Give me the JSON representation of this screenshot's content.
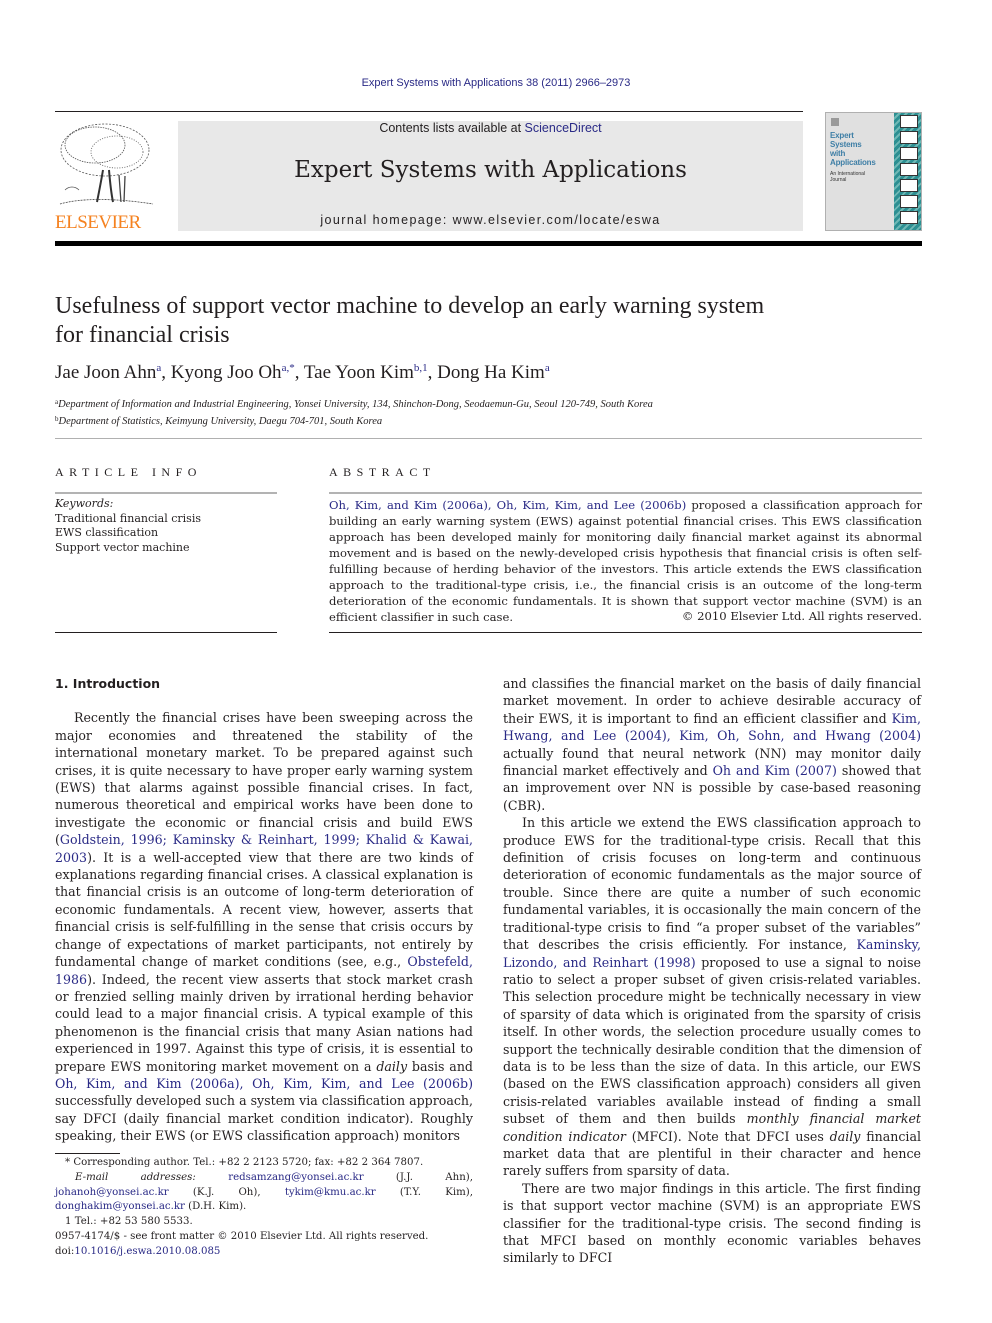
{
  "header": {
    "running_head": "Expert Systems with Applications 38 (2011) 2966–2973",
    "contents_prefix": "Contents lists available at ",
    "contents_link": "ScienceDirect",
    "journal_name": "Expert Systems with Applications",
    "homepage": "journal homepage: www.elsevier.com/locate/eswa",
    "publisher": "ELSEVIER",
    "cover_title_lines": [
      "Expert",
      "Systems",
      "with",
      "Applications"
    ],
    "cover_subtitle_lines": [
      "An International",
      "Journal"
    ],
    "colors": {
      "elsevier_orange": "#f58220",
      "link_blue": "#2a2a86",
      "masthead_gray": "#e8e8e8"
    }
  },
  "article": {
    "title_line1": "Usefulness of support vector machine to develop an early warning system",
    "title_line2": "for financial crisis",
    "authors": [
      {
        "name": "Jae Joon Ahn",
        "sup": "a",
        "sep": ", "
      },
      {
        "name": "Kyong Joo Oh",
        "sup": "a,*",
        "sep": ", "
      },
      {
        "name": "Tae Yoon Kim",
        "sup": "b,1",
        "sep": ", "
      },
      {
        "name": "Dong Ha Kim",
        "sup": "a",
        "sep": ""
      }
    ],
    "affiliations": [
      {
        "sup": "a",
        "text": "Department of Information and Industrial Engineering, Yonsei University, 134, Shinchon-Dong, Seodaemun-Gu, Seoul 120-749, South Korea"
      },
      {
        "sup": "b",
        "text": "Department of Statistics, Keimyung University, Daegu 704-701, South Korea"
      }
    ]
  },
  "article_info": {
    "heading": "ARTICLE INFO",
    "keywords_label": "Keywords:",
    "keywords": [
      "Traditional financial crisis",
      "EWS classification",
      "Support vector machine"
    ]
  },
  "abstract": {
    "heading": "ABSTRACT",
    "link": "Oh, Kim, and Kim (2006a), Oh, Kim, Kim, and Lee (2006b)",
    "text": " proposed a classification approach for building an early warning system (EWS) against potential financial crises. This EWS classification approach has been developed mainly for monitoring daily financial market against its abnormal movement and is based on the newly-developed crisis hypothesis that financial crisis is often self-fulfilling because of herding behavior of the investors. This article extends the EWS classification approach to the tradi­tional-type crisis, i.e., the financial crisis is an outcome of the long-term deterioration of the economic fundamentals. It is shown that support vector machine (SVM) is an efficient classifier in such case.",
    "copyright": "© 2010 Elsevier Ltd. All rights reserved."
  },
  "body": {
    "section_heading": "1. Introduction",
    "p1": {
      "a": "Recently the financial crises have been sweeping across the ma­jor economies and threatened the stability of the international monetary market. To be prepared against such crises, it is quite necessary to have proper early warning system (EWS) that alarms against possible financial crises. In fact, numerous theoretical and empirical works have been done to investigate the economic or financial crisis and build EWS (",
      "link1": "Goldstein, 1996; Kaminsky & Reinhart, 1999; Khalid & Kawai, 2003",
      "b": "). It is a well-accepted view that there are two kinds of explanations regarding financial crises. A classical explanation is that financial crisis is an outcome of long-term deterioration of economic fundamentals. A recent view, how­ever, asserts that financial crisis is self-fulfilling in the sense that crisis occurs by change of expectations of market participants, not entirely by fundamental change of market conditions (see, e.g., ",
      "link2": "Obstefeld, 1986",
      "c": "). Indeed, the recent view asserts that stock market crash or frenzied selling mainly driven by irrational herd­ing behavior could lead to a major financial crisis. A typical exam­ple of this phenomenon is the financial crisis that many Asian nations had experienced in 1997. Against this type of crisis, it is essential to prepare EWS monitoring market movement on a ",
      "em1": "daily",
      "d": " basis and ",
      "link3": "Oh, Kim, and Kim (2006a), Oh, Kim, Kim, and Lee (2006b)",
      "e": " successfully developed such a system via classification approach, say DFCI (daily financial market condition indicator). Roughly speaking, their EWS (or EWS classification approach) monitors"
    },
    "p2": {
      "a": "and classifies the financial market on the basis of daily financial market movement. In order to achieve desirable accuracy of their EWS, it is important to find an efficient classifier and ",
      "link1": "Kim, Hwang, and Lee (2004), Kim, Oh, Sohn, and Hwang (2004)",
      "b": " actually found that neural network (NN) may monitor daily financial market effectively and ",
      "link2": "Oh and Kim (2007)",
      "c": " showed that an improvement over NN is possible by case-based reasoning (CBR)."
    },
    "p3": {
      "a": "In this article we extend the EWS classification approach to pro­duce EWS for the traditional-type crisis. Recall that this definition of crisis focuses on long-term and continuous deterioration of eco­nomic fundamentals as the major source of trouble. Since there are quite a number of such economic fundamental variables, it is occa­sionally the main concern of the traditional-type crisis to find “a proper subset of the variables” that describes the crisis efficiently. For instance, ",
      "link1": "Kaminsky, Lizondo, and Reinhart (1998)",
      "b": " proposed to use a signal to noise ratio to select a proper subset of given crisis-related variables. This selection procedure might be technically necessary in view of sparsity of data which is originated from the sparsity of crisis itself. In other words, the selection procedure usu­ally comes to support the technically desirable condition that the dimension of data is to be less than the size of data. In this article, our EWS (based on the EWS classification approach) considers all given crisis-related variables available instead of finding a small subset of them and then builds ",
      "em1": "monthly financial market condition indicator",
      "c": " (MFCI). Note that DFCI uses ",
      "em2": "daily",
      "d": " financial market data that are plentiful in their character and hence rarely suffers from sparsity of data."
    },
    "p4": {
      "a": "There are two major findings in this article. The first finding is that support vector machine (SVM) is an appropriate EWS classifier for the traditional-type crisis. The second finding is that MFCI based on monthly economic variables behaves similarly to DFCI"
    }
  },
  "footnotes": {
    "corresponding": "* Corresponding author. Tel.: +82 2 2123 5720; fax: +82 2 364 7807.",
    "email_label": "E-mail addresses:",
    "emails": [
      {
        "addr": "redsamzang@yonsei.ac.kr",
        "who": " (J.J. Ahn), "
      },
      {
        "addr": "johanoh@yonsei.ac.kr",
        "who": " (K.J. Oh), "
      },
      {
        "addr": "tykim@kmu.ac.kr",
        "who": " (T.Y. Kim), "
      },
      {
        "addr": "donghakim@yonsei.ac.kr",
        "who": " (D.H. Kim)."
      }
    ],
    "fn1": "1 Tel.: +82 53 580 5533."
  },
  "front_matter": {
    "issn_line": "0957-4174/$ - see front matter © 2010 Elsevier Ltd. All rights reserved.",
    "doi_prefix": "doi:",
    "doi": "10.1016/j.eswa.2010.08.085"
  }
}
